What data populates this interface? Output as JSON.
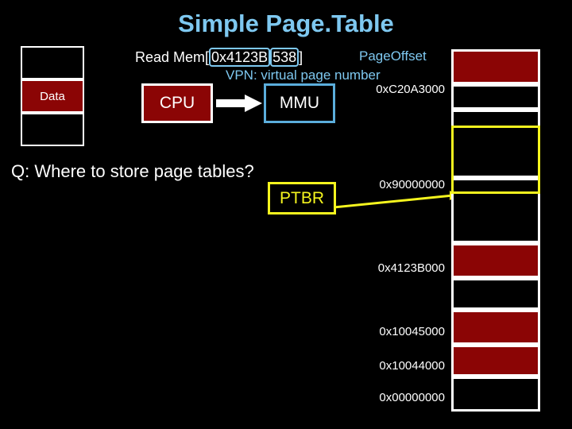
{
  "slide": {
    "title": "Simple Page.Table",
    "background_color": "#000000",
    "accent_blue": "#7EC8F0",
    "accent_red": "#8B0505",
    "accent_yellow": "#F5F51E"
  },
  "left_memory": {
    "cells": [
      {
        "label": "",
        "color": "#000000"
      },
      {
        "label": "Data",
        "color": "#8B0505"
      },
      {
        "label": "",
        "color": "#000000"
      }
    ]
  },
  "read_line": {
    "prefix": "Read Mem[",
    "vpn_bits": "0x4123B",
    "offset_bits": "538",
    "suffix": "]",
    "page_offset_label": "PageOffset",
    "vpn_label": "VPN: virtual page number"
  },
  "blocks": {
    "cpu": "CPU",
    "mmu": "MMU",
    "ptbr": "PTBR"
  },
  "question": "Q: Where to store page tables?",
  "right_memory": {
    "cells": [
      {
        "color": "#8B0505"
      },
      {
        "color": "#000000"
      },
      {
        "color": "#000000"
      },
      {
        "color": "#000000"
      },
      {
        "color": "#8B0505"
      },
      {
        "color": "#000000"
      },
      {
        "color": "#8B0505"
      },
      {
        "color": "#8B0505"
      },
      {
        "color": "#000000"
      }
    ],
    "addresses": [
      "0xC20A3000",
      "0x90000000",
      "0x4123B000",
      "0x10045000",
      "0x10044000",
      "0x00000000"
    ]
  }
}
